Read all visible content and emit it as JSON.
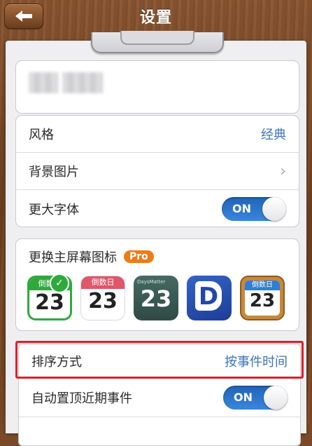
{
  "header": {
    "title": "设置",
    "back_icon": "back-arrow-icon"
  },
  "account": {
    "name_blurred": true
  },
  "appearance": {
    "rows": [
      {
        "label": "风格",
        "value": "经典",
        "accessory": ""
      },
      {
        "label": "背景图片",
        "value": "",
        "accessory": "chevron-right-icon"
      },
      {
        "label": "更大字体",
        "toggle": "ON"
      }
    ]
  },
  "home_icons": {
    "title": "更换主屏幕图标",
    "badge": "Pro",
    "icons": [
      {
        "band": "倒数日",
        "number": "23",
        "band_color": "#2eaa3c",
        "selected": true
      },
      {
        "band": "倒数日",
        "number": "23",
        "band_color": "#e0566a",
        "selected": false
      },
      {
        "band": "DaysMatter",
        "number": "23",
        "band_color": "",
        "selected": false
      },
      {
        "letter": "D",
        "selected": false
      },
      {
        "band": "倒数日",
        "number": "23",
        "band_color": "#2f7fd6",
        "selected": false
      }
    ]
  },
  "sort": {
    "label": "排序方式",
    "value": "按事件时间"
  },
  "auto_pin": {
    "label": "自动置顶近期事件",
    "toggle": "ON"
  },
  "colors": {
    "accent": "#3c74b8",
    "toggle_on": "#2a74cf",
    "highlight": "#e21e2a",
    "pro": "#ef7a16"
  }
}
